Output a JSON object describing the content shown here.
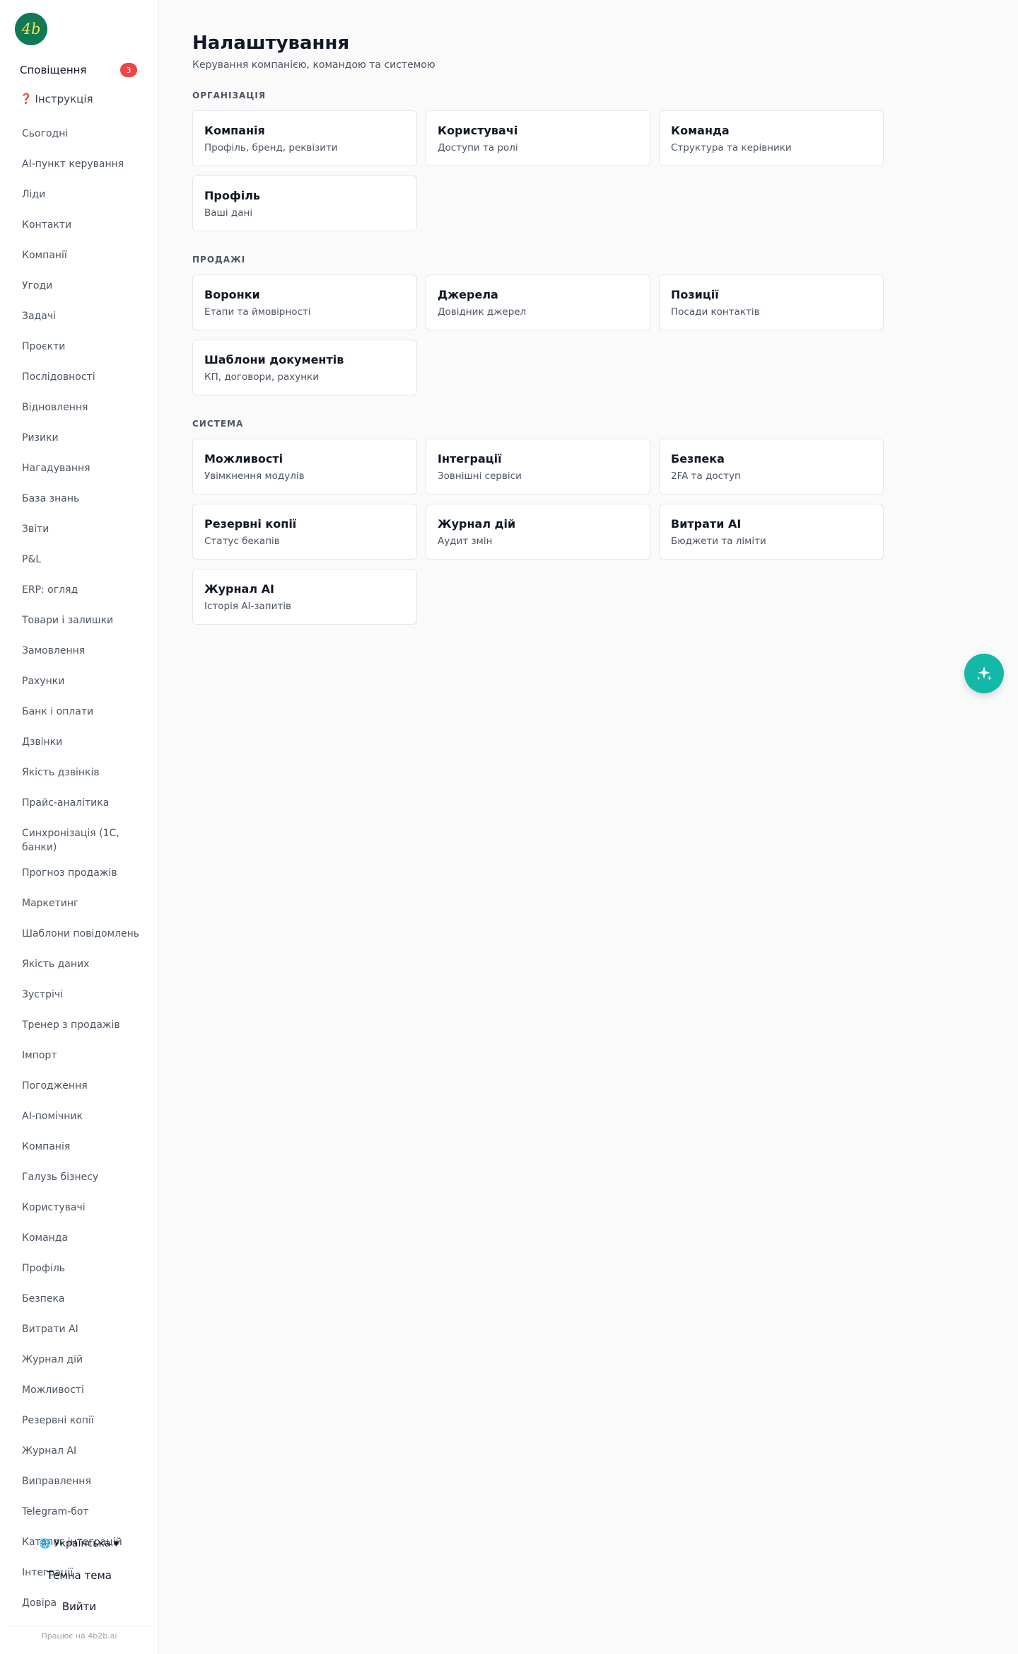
{
  "sidebar": {
    "logo_text": "4b",
    "notifications_label": "Сповіщення",
    "notifications_count": "3",
    "help_label": "Інструкція",
    "nav": [
      "Сьогодні",
      "AI-пункт керування",
      "Ліди",
      "Контакти",
      "Компанії",
      "Угоди",
      "Задачі",
      "Проєкти",
      "Послідовності",
      "Відновлення",
      "Ризики",
      "Нагадування",
      "База знань",
      "Звіти",
      "P&L",
      "ERP: огляд",
      "Товари і залишки",
      "Замовлення",
      "Рахунки",
      "Банк і оплати",
      "Дзвінки",
      "Якість дзвінків",
      "Прайс-аналітика",
      "Синхронізація (1С, банки)",
      "Прогноз продажів",
      "Маркетинг",
      "Шаблони повідомлень",
      "Якість даних",
      "Зустрічі",
      "Тренер з продажів",
      "Імпорт",
      "Погодження",
      "AI-помічник",
      "Компанія",
      "Галузь бізнесу",
      "Користувачі",
      "Команда",
      "Профіль",
      "Безпека",
      "Витрати AI",
      "Журнал дій",
      "Можливості",
      "Резервні копії",
      "Журнал AI",
      "Виправлення",
      "Telegram-бот",
      "Каталог інтеграцій",
      "Інтеграції",
      "Довіра"
    ],
    "language": "Українська",
    "dark_theme": "Темна тема",
    "logout": "Вийти",
    "powered_by": "Працює на 4b2b.ai"
  },
  "page": {
    "title": "Налаштування",
    "subtitle": "Керування компанією, командою та системою"
  },
  "sections": [
    {
      "title": "ОРГАНІЗАЦІЯ",
      "cards": [
        {
          "title": "Компанія",
          "desc": "Профіль, бренд, реквізити"
        },
        {
          "title": "Користувачі",
          "desc": "Доступи та ролі"
        },
        {
          "title": "Команда",
          "desc": "Структура та керівники"
        },
        {
          "title": "Профіль",
          "desc": "Ваші дані"
        }
      ]
    },
    {
      "title": "ПРОДАЖІ",
      "cards": [
        {
          "title": "Воронки",
          "desc": "Етапи та ймовірності"
        },
        {
          "title": "Джерела",
          "desc": "Довідник джерел"
        },
        {
          "title": "Позиції",
          "desc": "Посади контактів"
        },
        {
          "title": "Шаблони документів",
          "desc": "КП, договори, рахунки"
        }
      ]
    },
    {
      "title": "СИСТЕМА",
      "cards": [
        {
          "title": "Можливості",
          "desc": "Увімкнення модулів"
        },
        {
          "title": "Інтеграції",
          "desc": "Зовнішні сервіси"
        },
        {
          "title": "Безпека",
          "desc": "2FA та доступ"
        },
        {
          "title": "Резервні копії",
          "desc": "Статус бекапів"
        },
        {
          "title": "Журнал дій",
          "desc": "Аудит змін"
        },
        {
          "title": "Витрати AI",
          "desc": "Бюджети та ліміти"
        },
        {
          "title": "Журнал AI",
          "desc": "Історія AI-запитів"
        }
      ]
    }
  ],
  "colors": {
    "accent": "#14b8a6",
    "logo_bg": "#0f7a55",
    "badge": "#ef4444"
  }
}
